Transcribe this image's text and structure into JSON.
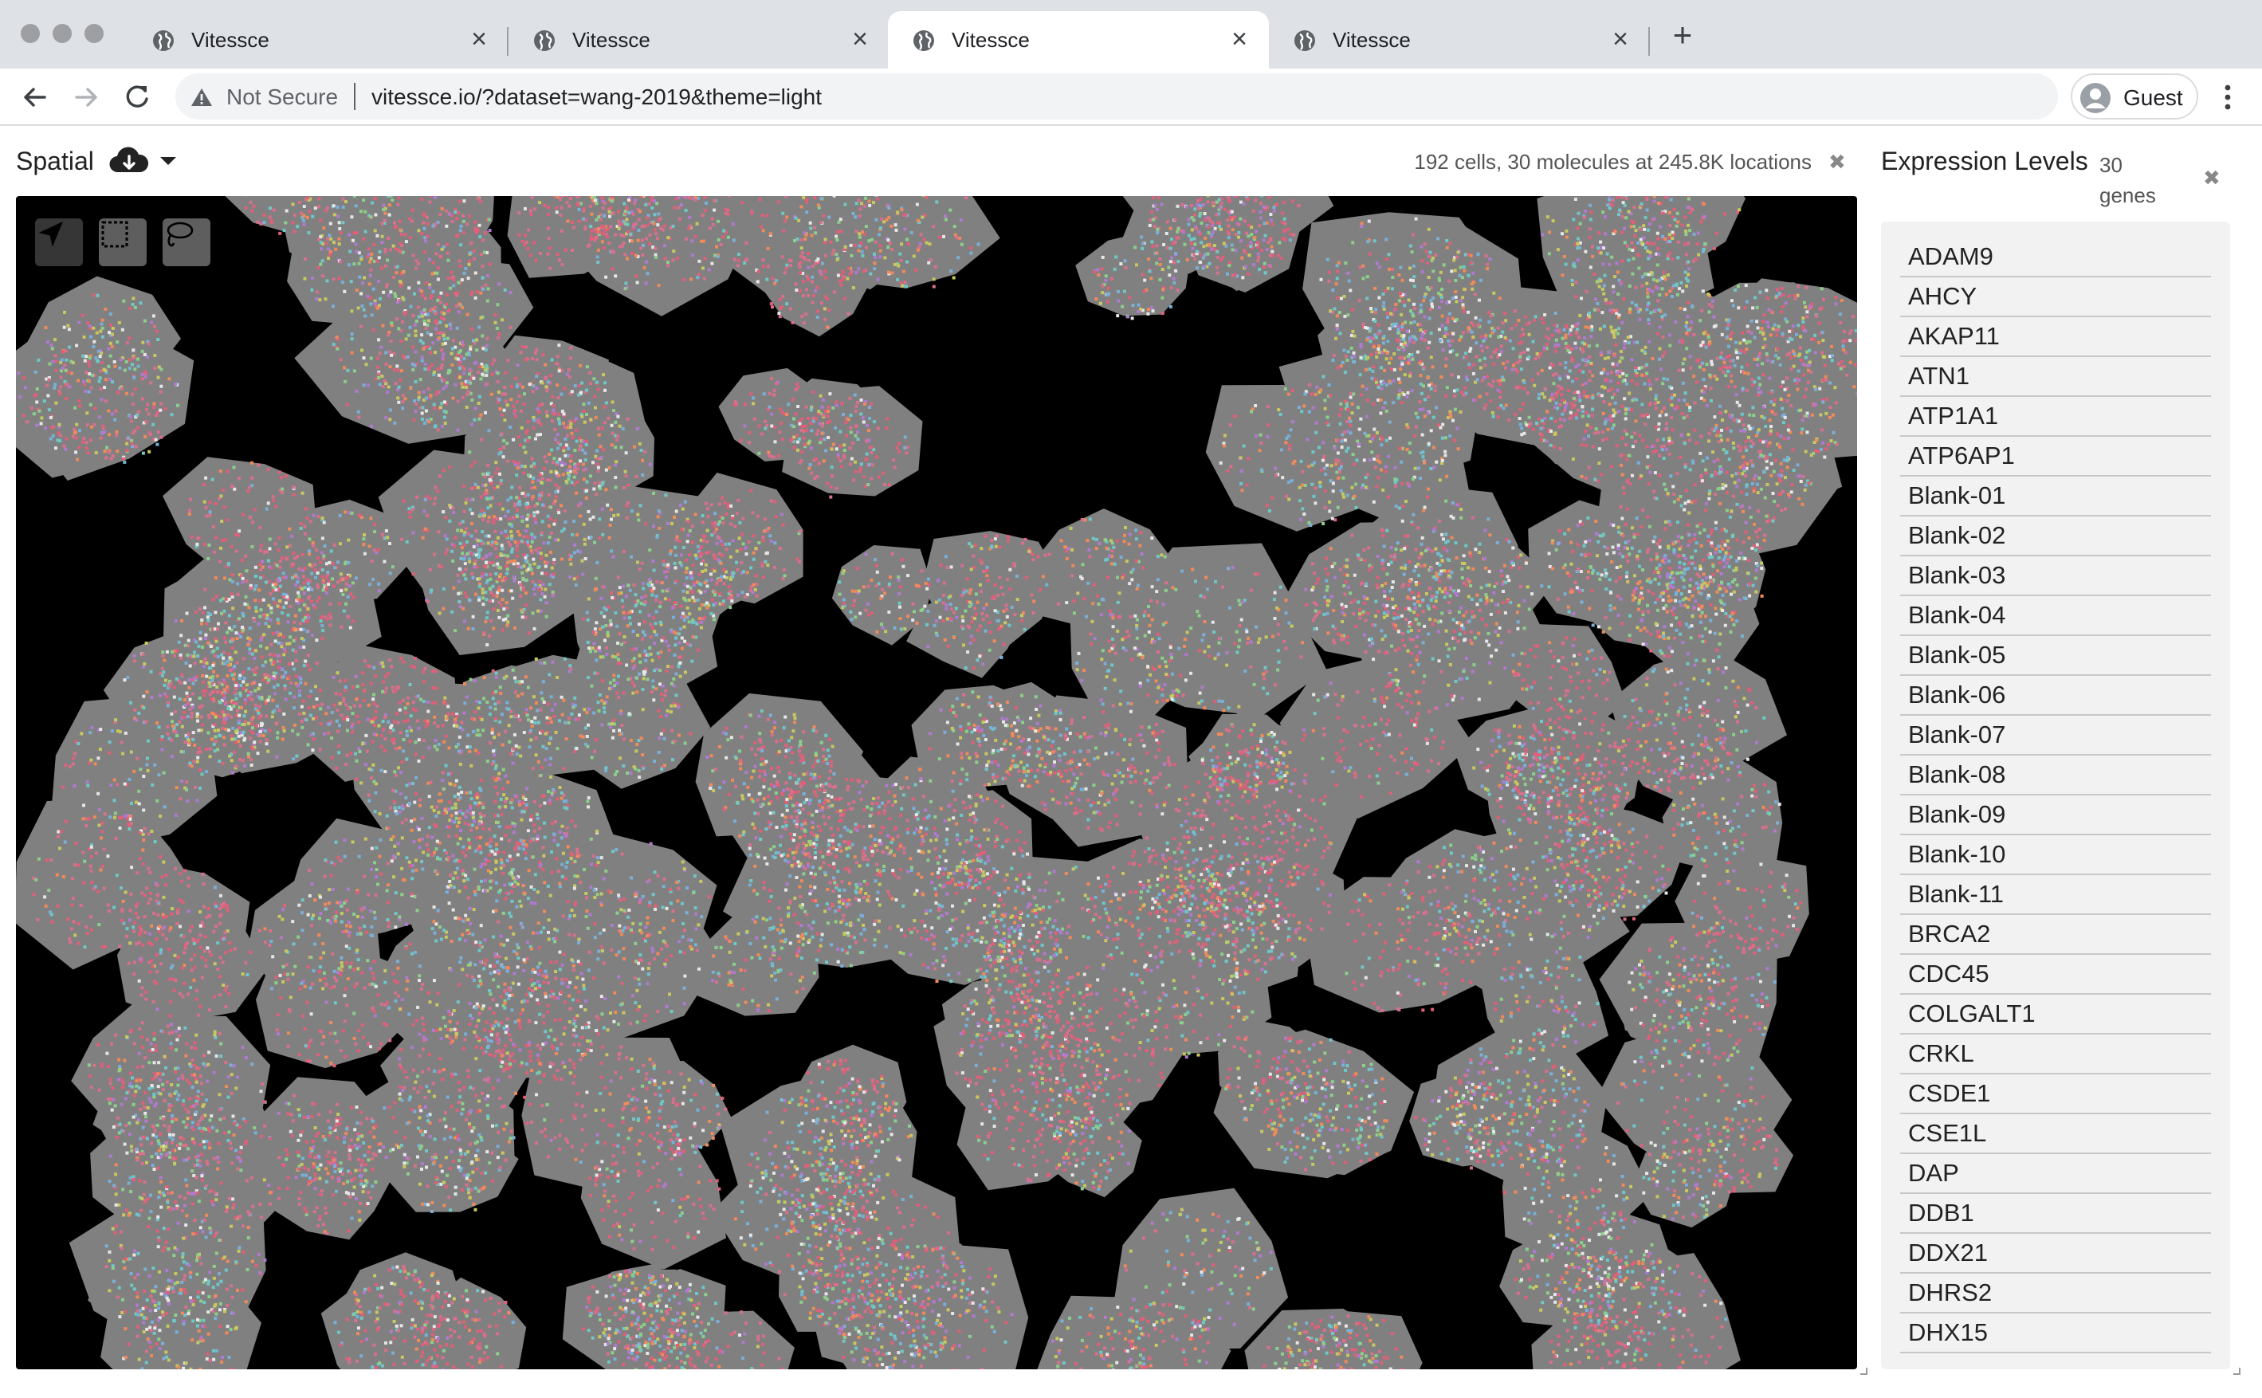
{
  "browser": {
    "tabs": [
      {
        "title": "Vitessce",
        "active": false
      },
      {
        "title": "Vitessce",
        "active": false
      },
      {
        "title": "Vitessce",
        "active": true
      },
      {
        "title": "Vitessce",
        "active": false
      }
    ],
    "tab_close_glyph": "×",
    "new_tab_glyph": "+",
    "security_label": "Not Secure",
    "url": "vitessce.io/?dataset=wang-2019&theme=light",
    "profile_label": "Guest"
  },
  "spatial": {
    "title": "Spatial",
    "subtitle": "192 cells, 30 molecules at 245.8K locations",
    "close_glyph": "✖",
    "tools": [
      "pan-tool",
      "rectangle-select-tool",
      "lasso-select-tool"
    ],
    "active_tool": "pan-tool",
    "colors": {
      "background": "#000000",
      "cell_fill": "#808080",
      "molecule_colors": [
        "#e0607a",
        "#d8708c",
        "#7ab0d8",
        "#8ccf8a",
        "#c8c860",
        "#b07ad0",
        "#6fc7c7",
        "#f08a5a",
        "#e6e6e6"
      ]
    }
  },
  "expression": {
    "title": "Expression Levels",
    "count_label": "30 genes",
    "close_glyph": "✖",
    "genes": [
      "ADAM9",
      "AHCY",
      "AKAP11",
      "ATN1",
      "ATP1A1",
      "ATP6AP1",
      "Blank-01",
      "Blank-02",
      "Blank-03",
      "Blank-04",
      "Blank-05",
      "Blank-06",
      "Blank-07",
      "Blank-08",
      "Blank-09",
      "Blank-10",
      "Blank-11",
      "BRCA2",
      "CDC45",
      "COLGALT1",
      "CRKL",
      "CSDE1",
      "CSE1L",
      "DAP",
      "DDB1",
      "DDX21",
      "DHRS2",
      "DHX15"
    ]
  }
}
